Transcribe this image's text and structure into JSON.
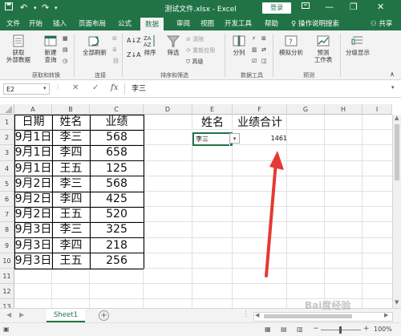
{
  "titlebar": {
    "title": "测试文件.xlsx  -  Excel",
    "login": "登录",
    "undo": "↶",
    "redo": "↷",
    "min": "—",
    "restore": "❐",
    "close": "✕"
  },
  "tabs": [
    "文件",
    "开始",
    "插入",
    "页面布局",
    "公式",
    "数据",
    "审阅",
    "视图",
    "开发工具",
    "帮助"
  ],
  "tellme": "操作说明搜索",
  "share": "共享",
  "ribbon": {
    "get_data": "获取\n外部数据",
    "new_query": "新建\n查询",
    "refresh_all": "全部刷新",
    "sort": "排序",
    "filter": "筛选",
    "clear": "清除",
    "reapply": "重新应用",
    "advanced": "高级",
    "split": "分列",
    "what_if": "模拟分析",
    "forecast": "预测\n工作表",
    "outline": "分级显示",
    "groups": {
      "get_transform": "获取和转换",
      "connections": "连接",
      "sort_filter": "排序和筛选",
      "data_tools": "数据工具",
      "forecast": "预测"
    }
  },
  "formula_bar": {
    "name_box": "E2",
    "cancel": "✕",
    "enter": "✓",
    "fx": "fx",
    "content": "李三"
  },
  "columns": [
    "A",
    "B",
    "C",
    "D",
    "E",
    "F",
    "G",
    "H",
    "I"
  ],
  "rows": [
    "1",
    "2",
    "3",
    "4",
    "5",
    "6",
    "7",
    "8",
    "9",
    "10",
    "11",
    "12",
    "13",
    "14",
    "15"
  ],
  "table": {
    "headers": [
      "日期",
      "姓名",
      "业绩"
    ],
    "rows": [
      [
        "9月1日",
        "李三",
        "568"
      ],
      [
        "9月1日",
        "李四",
        "658"
      ],
      [
        "9月1日",
        "王五",
        "125"
      ],
      [
        "9月2日",
        "李三",
        "568"
      ],
      [
        "9月2日",
        "李四",
        "425"
      ],
      [
        "9月2日",
        "王五",
        "520"
      ],
      [
        "9月3日",
        "李三",
        "325"
      ],
      [
        "9月3日",
        "李四",
        "218"
      ],
      [
        "9月3日",
        "王五",
        "256"
      ]
    ]
  },
  "summary": {
    "name_header": "姓名",
    "total_header": "业绩合计",
    "selected_name": "李三",
    "total_value": "1461"
  },
  "sheet_tab": "Sheet1",
  "add_sheet": "+",
  "status": {
    "zoom": "100%",
    "minus": "−",
    "plus": "+"
  },
  "watermark": "Bai度经验",
  "colors": {
    "excel_green": "#217346",
    "arrow_red": "#e53935",
    "selection": "#217346"
  }
}
